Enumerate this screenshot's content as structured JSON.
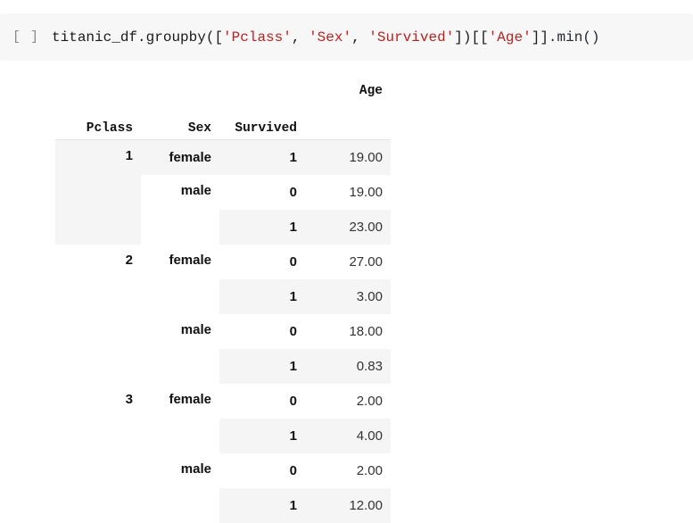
{
  "notebook": {
    "cell": {
      "prompt": "[ ]",
      "code_tokens": [
        {
          "text": "titanic_df.groupby([",
          "kind": "plain"
        },
        {
          "text": "'Pclass'",
          "kind": "string"
        },
        {
          "text": ", ",
          "kind": "plain"
        },
        {
          "text": "'Sex'",
          "kind": "string"
        },
        {
          "text": ", ",
          "kind": "plain"
        },
        {
          "text": "'Survived'",
          "kind": "string"
        },
        {
          "text": "])[[",
          "kind": "plain"
        },
        {
          "text": "'Age'",
          "kind": "string"
        },
        {
          "text": "]]",
          "kind": "plain"
        },
        {
          "text": ".min()",
          "kind": "function"
        }
      ],
      "code_plain": "titanic_df.groupby(['Pclass', 'Sex', 'Survived'])[['Age']].min()"
    }
  },
  "colors": {
    "cell_background": "#f7f7f7",
    "string_literal": "#ba2121",
    "code_text": "#1a1a1a",
    "prompt_text": "#8a8a8a",
    "row_stripe": "#f5f5f5",
    "row_plain": "#ffffff",
    "header_rule": "#e6e6e6"
  },
  "chart_data": {
    "type": "table",
    "title": "",
    "value_column_header": "Age",
    "index_names": [
      "Pclass",
      "Sex",
      "Survived"
    ],
    "columns": [
      "Pclass",
      "Sex",
      "Survived",
      "Age"
    ],
    "rows": [
      {
        "pclass": "1",
        "sex": "female",
        "survived": "1",
        "age": "19.00"
      },
      {
        "pclass": "",
        "sex": "male",
        "survived": "0",
        "age": "19.00"
      },
      {
        "pclass": "",
        "sex": "",
        "survived": "1",
        "age": "23.00"
      },
      {
        "pclass": "2",
        "sex": "female",
        "survived": "0",
        "age": "27.00"
      },
      {
        "pclass": "",
        "sex": "",
        "survived": "1",
        "age": "3.00"
      },
      {
        "pclass": "",
        "sex": "male",
        "survived": "0",
        "age": "18.00"
      },
      {
        "pclass": "",
        "sex": "",
        "survived": "1",
        "age": "0.83"
      },
      {
        "pclass": "3",
        "sex": "female",
        "survived": "0",
        "age": "2.00"
      },
      {
        "pclass": "",
        "sex": "",
        "survived": "1",
        "age": "4.00"
      },
      {
        "pclass": "",
        "sex": "male",
        "survived": "0",
        "age": "2.00"
      },
      {
        "pclass": "",
        "sex": "",
        "survived": "1",
        "age": "12.00"
      }
    ],
    "blank_header": ""
  },
  "table": {
    "header": {
      "blank1": "",
      "blank2": "",
      "blank3": "",
      "age": "Age",
      "pclass": "Pclass",
      "sex": "Sex",
      "survived": "Survived"
    },
    "body": [
      {
        "pclass": "1",
        "sex": "female",
        "survived": "1",
        "age": "19.00",
        "stripe": true,
        "pclass_span": 3,
        "sex_span": 1,
        "pclass_stripe": true,
        "sex_stripe": true
      },
      {
        "pclass": "",
        "sex": "male",
        "survived": "0",
        "age": "19.00",
        "stripe": false,
        "pclass_span": 0,
        "sex_span": 2,
        "pclass_stripe": false,
        "sex_stripe": false
      },
      {
        "pclass": "",
        "sex": "",
        "survived": "1",
        "age": "23.00",
        "stripe": true,
        "pclass_span": 0,
        "sex_span": 0,
        "pclass_stripe": false,
        "sex_stripe": false
      },
      {
        "pclass": "2",
        "sex": "female",
        "survived": "0",
        "age": "27.00",
        "stripe": false,
        "pclass_span": 4,
        "sex_span": 2,
        "pclass_stripe": false,
        "sex_stripe": false
      },
      {
        "pclass": "",
        "sex": "",
        "survived": "1",
        "age": "3.00",
        "stripe": true,
        "pclass_span": 0,
        "sex_span": 0,
        "pclass_stripe": false,
        "sex_stripe": false
      },
      {
        "pclass": "",
        "sex": "male",
        "survived": "0",
        "age": "18.00",
        "stripe": false,
        "pclass_span": 0,
        "sex_span": 2,
        "pclass_stripe": false,
        "sex_stripe": false
      },
      {
        "pclass": "",
        "sex": "",
        "survived": "1",
        "age": "0.83",
        "stripe": true,
        "pclass_span": 0,
        "sex_span": 0,
        "pclass_stripe": false,
        "sex_stripe": false
      },
      {
        "pclass": "3",
        "sex": "female",
        "survived": "0",
        "age": "2.00",
        "stripe": false,
        "pclass_span": 4,
        "sex_span": 2,
        "pclass_stripe": false,
        "sex_stripe": false
      },
      {
        "pclass": "",
        "sex": "",
        "survived": "1",
        "age": "4.00",
        "stripe": true,
        "pclass_span": 0,
        "sex_span": 0,
        "pclass_stripe": false,
        "sex_stripe": false
      },
      {
        "pclass": "",
        "sex": "male",
        "survived": "0",
        "age": "2.00",
        "stripe": false,
        "pclass_span": 0,
        "sex_span": 2,
        "pclass_stripe": false,
        "sex_stripe": false
      },
      {
        "pclass": "",
        "sex": "",
        "survived": "1",
        "age": "12.00",
        "stripe": true,
        "pclass_span": 0,
        "sex_span": 0,
        "pclass_stripe": false,
        "sex_stripe": false
      }
    ]
  }
}
